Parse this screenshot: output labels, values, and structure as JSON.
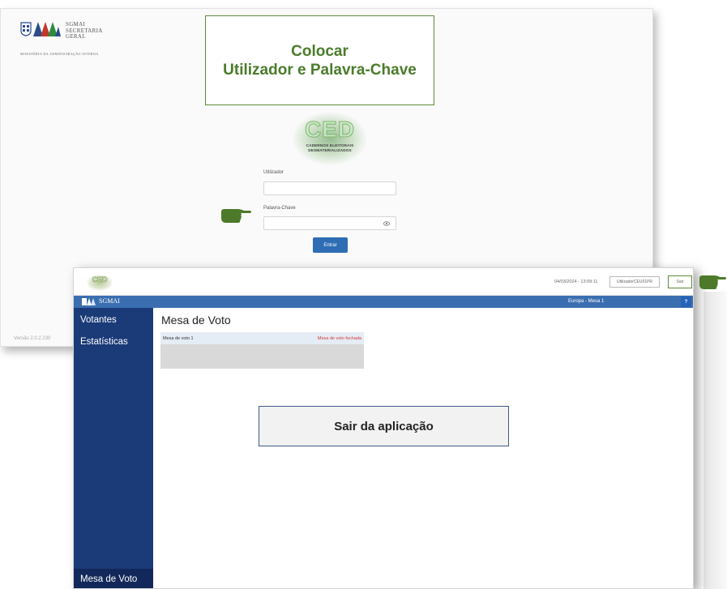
{
  "login": {
    "logo": {
      "line1": "SGMAI",
      "line2": "SECRETARIA",
      "line3": "GERAL",
      "ministry": "MINISTÉRIO DA ADMINISTRAÇÃO INTERNA"
    },
    "callout_line1": "Colocar",
    "callout_line2": "Utilizador e Palavra-Chave",
    "ced": {
      "letters": "CED",
      "caption_line1": "CADERNOS ELEITORAIS",
      "caption_line2": "DESMATERIALIZADOS"
    },
    "user_label": "Utilizador",
    "user_value": "",
    "password_label": "Palavra-Chave",
    "password_value": "",
    "submit_label": "Entrar",
    "version": "Versão 2.0.2.230"
  },
  "app": {
    "datetime": "04/03/2024 - 13:09:11",
    "user_button": "UtilizadorCEU01PR",
    "logout_button": "Sair",
    "brand": "SGMAI",
    "location": "Europa - Mesa 1",
    "help": "?",
    "sidebar": {
      "items": [
        {
          "label": "Votantes"
        },
        {
          "label": "Estatísticas"
        }
      ],
      "bottom": "Mesa de Voto"
    },
    "main": {
      "title": "Mesa de Voto",
      "card": {
        "name": "Mesa de voto 1",
        "status": "Mesa de voto fechada"
      }
    },
    "callout": "Sair da aplicação"
  },
  "colors": {
    "callout_green": "#4a7c2b",
    "app_bar_blue": "#3b6eb0",
    "sidebar_navy": "#1a3a78",
    "button_blue": "#2e6db4",
    "status_red": "#d63a3a"
  },
  "icons": [
    "pointing-hand-icon",
    "eye-icon",
    "help-icon",
    "shield-icon"
  ]
}
